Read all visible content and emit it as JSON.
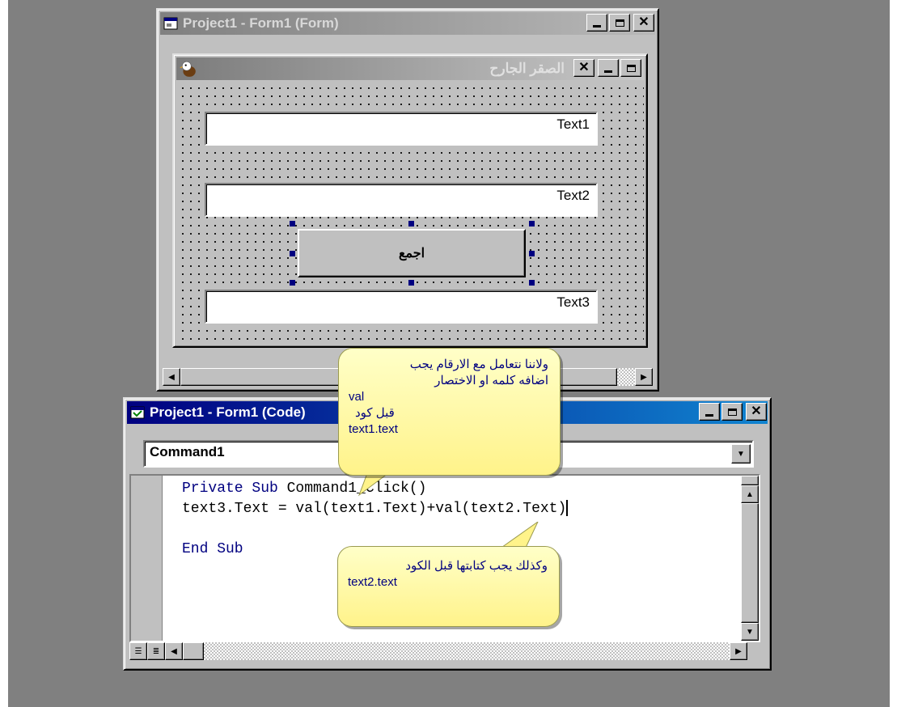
{
  "form_designer": {
    "title": "Project1 - Form1 (Form)",
    "inner_form": {
      "caption": "الصقر الجارح",
      "text1": "Text1",
      "text2": "Text2",
      "text3": "Text3",
      "command_caption": "اجمع"
    }
  },
  "code_window": {
    "title": "Project1 - Form1 (Code)",
    "object_combo": "Command1",
    "code": {
      "line1_kw1": "Private Sub ",
      "line1_rest": "Command1_Click()",
      "line2": "text3.Text = val(text1.Text)+val(text2.Text)",
      "line4": "End Sub"
    }
  },
  "callouts": {
    "first": {
      "line1": "ولاننا نتعامل مع الارقام يجب",
      "line2": "اضافه كلمه او الاختصار",
      "line3": "val",
      "line4": "قبل كود",
      "line5": "text1.text"
    },
    "second": {
      "line1": "وكذلك يجب كتابتها قبل الكود",
      "line2": "text2.text"
    }
  },
  "colors": {
    "workspace": "#808080",
    "keyword": "#000080",
    "active_title": "#000080",
    "callout_fill": "#fff38a",
    "selection_handle": "#000080"
  },
  "icons": [
    "form-icon",
    "eagle-icon",
    "code-module-icon",
    "minimize-icon",
    "maximize-icon",
    "close-icon",
    "dropdown-arrow-icon",
    "scroll-arrow-icon",
    "procedure-view-icon",
    "full-module-view-icon"
  ]
}
